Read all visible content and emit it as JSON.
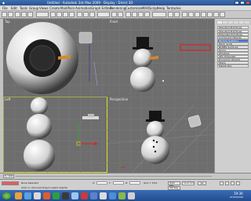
{
  "title": {
    "text": "Untitled - Autodesk 3ds Max 2009 - Display : Direct 3D"
  },
  "menus": [
    "File",
    "Edit",
    "Tools",
    "Group",
    "Views",
    "Create",
    "Modifiers",
    "Animation",
    "Graph Editors",
    "Rendering",
    "Customize",
    "MAXScript",
    "Help",
    "Tentacles"
  ],
  "viewports": {
    "top": "Top",
    "front": "Front",
    "left": "Left",
    "perspective": "Perspective"
  },
  "panel": {
    "dropdown": "Standard Primitives",
    "items": [
      "Standard Primitives",
      "Extended Primitives",
      "Compound Objects",
      "Particle Systems",
      "Patch Grids",
      "NURBS Surfaces",
      "Doors",
      "Windows",
      "AEC Extended",
      "Dynamics Objects",
      "Stairs",
      "Mental Ray"
    ]
  },
  "status": {
    "left": "None Selected",
    "hint": "Click or click-and-drag to select objects",
    "x": "X:",
    "y": "Y:",
    "z": "Z:",
    "grid": "Grid = 10.0",
    "autokey": "Auto Key",
    "setkey": "Set Key",
    "selected": "Selected"
  },
  "time": {
    "frame": "0 / 100"
  },
  "taskbar": {
    "clock_time": "19:30",
    "clock_date": "07/03/2010"
  },
  "colors": {
    "viewport_bg": "#6e6e6e",
    "active_border": "#e4e41a",
    "highlight": "#3a6fd2",
    "red_arrow": "#e02020"
  }
}
